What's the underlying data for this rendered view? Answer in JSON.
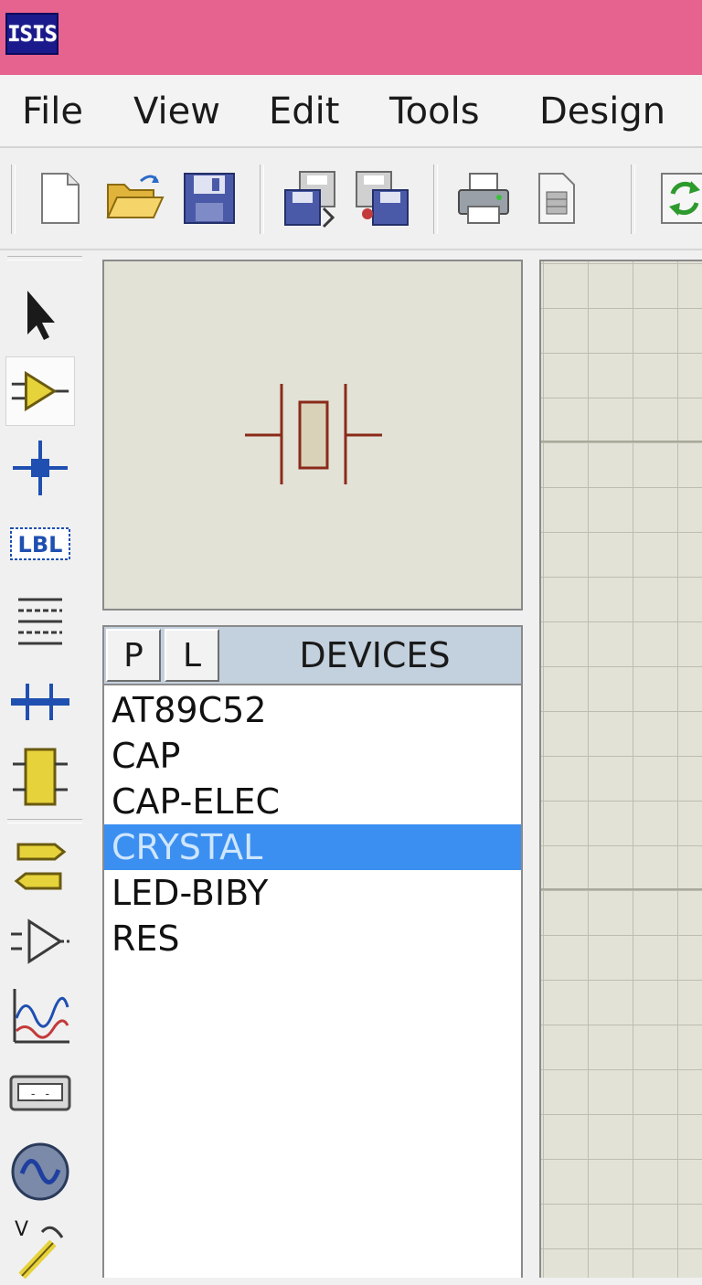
{
  "titlebar": {
    "logo_text": "ISIS",
    "color": "#e6628f"
  },
  "menu": {
    "items": [
      {
        "label": "File"
      },
      {
        "label": "View"
      },
      {
        "label": "Edit"
      },
      {
        "label": "Tools"
      },
      {
        "label": "Design"
      }
    ]
  },
  "toolbar": {
    "buttons": [
      {
        "icon": "new-file-icon"
      },
      {
        "icon": "open-folder-icon"
      },
      {
        "icon": "save-disk-icon"
      },
      {
        "icon": "import-section-icon"
      },
      {
        "icon": "export-section-icon"
      },
      {
        "icon": "print-icon"
      },
      {
        "icon": "set-area-icon"
      },
      {
        "icon": "refresh-icon"
      }
    ]
  },
  "toolstrip": {
    "tools": [
      {
        "icon": "selection-arrow-icon"
      },
      {
        "icon": "component-mode-icon",
        "active": true
      },
      {
        "icon": "junction-dot-icon"
      },
      {
        "icon": "wire-label-icon",
        "text": "LBL"
      },
      {
        "icon": "text-script-icon"
      },
      {
        "icon": "bus-icon"
      },
      {
        "icon": "subcircuit-icon"
      },
      {
        "icon": "terminals-icon"
      },
      {
        "icon": "device-pins-icon"
      },
      {
        "icon": "graph-icon"
      },
      {
        "icon": "tape-recorder-icon"
      },
      {
        "icon": "generator-icon"
      },
      {
        "icon": "voltage-probe-icon"
      }
    ]
  },
  "devices": {
    "p_label": "P",
    "l_label": "L",
    "title": "DEVICES",
    "items": [
      {
        "name": "AT89C52",
        "selected": false
      },
      {
        "name": "CAP",
        "selected": false
      },
      {
        "name": "CAP-ELEC",
        "selected": false
      },
      {
        "name": "CRYSTAL",
        "selected": true
      },
      {
        "name": "LED-BIBY",
        "selected": false
      },
      {
        "name": "RES",
        "selected": false
      }
    ],
    "selected_color": "#3b8ff0",
    "header_color": "#c3d0de"
  },
  "preview": {
    "symbol": "crystal-symbol-icon",
    "background": "#e2e2d6"
  }
}
